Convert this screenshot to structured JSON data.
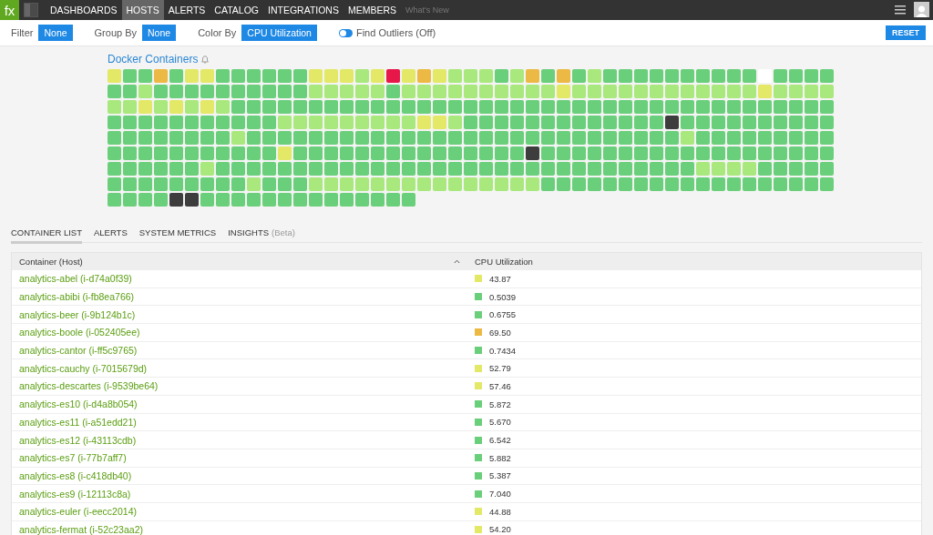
{
  "nav": {
    "logo": "fx",
    "items": [
      {
        "label": "DASHBOARDS",
        "selected": false
      },
      {
        "label": "HOSTS",
        "selected": true
      },
      {
        "label": "ALERTS",
        "selected": false
      },
      {
        "label": "CATALOG",
        "selected": false
      },
      {
        "label": "INTEGRATIONS",
        "selected": false
      },
      {
        "label": "MEMBERS",
        "selected": false
      }
    ],
    "whats_new": "What's New"
  },
  "toolbar": {
    "filters": [
      {
        "label": "Filter",
        "value": "None"
      },
      {
        "label": "Group By",
        "value": "None"
      },
      {
        "label": "Color By",
        "value": "CPU Utilization"
      }
    ],
    "outliers": {
      "label": "Find Outliers (Off)",
      "on": false
    },
    "reset": "RESET"
  },
  "heatmap": {
    "title": "Docker Containers",
    "rows": [
      {
        "cells": [
          {
            "color": "#e3e867"
          },
          {
            "color": "#6acf7a"
          },
          {
            "color": "#6acf7a"
          },
          {
            "color": "#ecb944"
          },
          {
            "color": "#6acf7a"
          },
          {
            "color": "#e3e867"
          },
          {
            "color": "#e3e867"
          },
          {
            "color": "#6acf7a"
          },
          {
            "color": "#6acf7a"
          },
          {
            "color": "#6acf7a"
          },
          {
            "color": "#6acf7a"
          },
          {
            "color": "#6acf7a"
          },
          {
            "color": "#6acf7a"
          },
          {
            "color": "#e3e867"
          },
          {
            "color": "#e3e867"
          },
          {
            "color": "#e3e867"
          },
          {
            "color": "#a9e87c"
          },
          {
            "color": "#e3e867"
          },
          {
            "color": "#e8174a"
          },
          {
            "color": "#e3e867"
          },
          {
            "color": "#ecb944"
          },
          {
            "color": "#e3e867"
          },
          {
            "color": "#a9e87c"
          },
          {
            "color": "#a9e87c"
          },
          {
            "color": "#a9e87c"
          },
          {
            "color": "#6acf7a"
          },
          {
            "color": "#a9e87c"
          },
          {
            "color": "#ecb944"
          },
          {
            "color": "#6acf7a"
          },
          {
            "color": "#ecb944"
          },
          {
            "color": "#6acf7a"
          },
          {
            "color": "#a9e87c"
          },
          {
            "color": "#6acf7a"
          },
          {
            "color": "#6acf7a"
          },
          {
            "color": "#6acf7a"
          },
          {
            "color": "#6acf7a"
          },
          {
            "color": "#6acf7a"
          },
          {
            "color": "#6acf7a"
          },
          {
            "color": "#6acf7a"
          },
          {
            "color": "#6acf7a"
          },
          {
            "color": "#6acf7a"
          },
          {
            "color": "#6acf7a"
          },
          {
            "color": "#ffffff"
          },
          {
            "color": "#6acf7a"
          },
          {
            "color": "#6acf7a"
          },
          {
            "color": "#6acf7a"
          },
          {
            "color": "#6acf7a"
          }
        ]
      },
      {
        "cells": [
          {
            "color": "#6acf7a"
          },
          {
            "color": "#6acf7a"
          },
          {
            "color": "#a9e87c"
          },
          {
            "color": "#6acf7a"
          },
          {
            "color": "#6acf7a"
          },
          {
            "color": "#6acf7a"
          },
          {
            "color": "#6acf7a"
          },
          {
            "color": "#6acf7a"
          },
          {
            "color": "#6acf7a"
          },
          {
            "color": "#6acf7a"
          },
          {
            "color": "#6acf7a"
          },
          {
            "color": "#6acf7a"
          },
          {
            "color": "#6acf7a"
          },
          {
            "color": "#a9e87c"
          },
          {
            "color": "#a9e87c"
          },
          {
            "color": "#a9e87c"
          },
          {
            "color": "#a9e87c"
          },
          {
            "color": "#a9e87c"
          },
          {
            "color": "#6acf7a"
          },
          {
            "color": "#a9e87c"
          },
          {
            "color": "#a9e87c"
          },
          {
            "color": "#a9e87c"
          },
          {
            "color": "#a9e87c"
          },
          {
            "color": "#a9e87c"
          },
          {
            "color": "#a9e87c"
          },
          {
            "color": "#a9e87c"
          },
          {
            "color": "#a9e87c"
          },
          {
            "color": "#a9e87c"
          },
          {
            "color": "#a9e87c"
          },
          {
            "color": "#e3e867"
          },
          {
            "color": "#a9e87c"
          },
          {
            "color": "#a9e87c"
          },
          {
            "color": "#a9e87c"
          },
          {
            "color": "#a9e87c"
          },
          {
            "color": "#a9e87c"
          },
          {
            "color": "#a9e87c"
          },
          {
            "color": "#a9e87c"
          },
          {
            "color": "#a9e87c"
          },
          {
            "color": "#a9e87c"
          },
          {
            "color": "#a9e87c"
          },
          {
            "color": "#a9e87c"
          },
          {
            "color": "#a9e87c"
          },
          {
            "color": "#e3e867"
          },
          {
            "color": "#a9e87c"
          },
          {
            "color": "#a9e87c"
          },
          {
            "color": "#a9e87c"
          },
          {
            "color": "#a9e87c"
          }
        ]
      },
      {
        "cells": [
          {
            "color": "#a9e87c"
          },
          {
            "color": "#a9e87c"
          },
          {
            "color": "#e3e867"
          },
          {
            "color": "#a9e87c"
          },
          {
            "color": "#e3e867"
          },
          {
            "color": "#a9e87c"
          },
          {
            "color": "#e3e867"
          },
          {
            "color": "#a9e87c"
          },
          {
            "color": "#6acf7a"
          },
          {
            "color": "#6acf7a"
          },
          {
            "color": "#6acf7a"
          },
          {
            "color": "#6acf7a"
          },
          {
            "color": "#6acf7a"
          },
          {
            "color": "#6acf7a"
          },
          {
            "color": "#6acf7a"
          },
          {
            "color": "#6acf7a"
          },
          {
            "color": "#6acf7a"
          },
          {
            "color": "#6acf7a"
          },
          {
            "color": "#6acf7a"
          },
          {
            "color": "#6acf7a"
          },
          {
            "color": "#6acf7a"
          },
          {
            "color": "#6acf7a"
          },
          {
            "color": "#6acf7a"
          },
          {
            "color": "#6acf7a"
          },
          {
            "color": "#6acf7a"
          },
          {
            "color": "#6acf7a"
          },
          {
            "color": "#6acf7a"
          },
          {
            "color": "#6acf7a"
          },
          {
            "color": "#6acf7a"
          },
          {
            "color": "#6acf7a"
          },
          {
            "color": "#6acf7a"
          },
          {
            "color": "#6acf7a"
          },
          {
            "color": "#6acf7a"
          },
          {
            "color": "#6acf7a"
          },
          {
            "color": "#6acf7a"
          },
          {
            "color": "#6acf7a"
          },
          {
            "color": "#6acf7a"
          },
          {
            "color": "#6acf7a"
          },
          {
            "color": "#6acf7a"
          },
          {
            "color": "#6acf7a"
          },
          {
            "color": "#6acf7a"
          },
          {
            "color": "#6acf7a"
          },
          {
            "color": "#6acf7a"
          },
          {
            "color": "#6acf7a"
          },
          {
            "color": "#6acf7a"
          },
          {
            "color": "#6acf7a"
          },
          {
            "color": "#6acf7a"
          }
        ]
      },
      {
        "cells": [
          {
            "color": "#6acf7a"
          },
          {
            "color": "#6acf7a"
          },
          {
            "color": "#6acf7a"
          },
          {
            "color": "#6acf7a"
          },
          {
            "color": "#6acf7a"
          },
          {
            "color": "#6acf7a"
          },
          {
            "color": "#6acf7a"
          },
          {
            "color": "#6acf7a"
          },
          {
            "color": "#6acf7a"
          },
          {
            "color": "#6acf7a"
          },
          {
            "color": "#6acf7a"
          },
          {
            "color": "#a9e87c"
          },
          {
            "color": "#a9e87c"
          },
          {
            "color": "#a9e87c"
          },
          {
            "color": "#a9e87c"
          },
          {
            "color": "#a9e87c"
          },
          {
            "color": "#a9e87c"
          },
          {
            "color": "#a9e87c"
          },
          {
            "color": "#a9e87c"
          },
          {
            "color": "#a9e87c"
          },
          {
            "color": "#e3e867"
          },
          {
            "color": "#e3e867"
          },
          {
            "color": "#a9e87c"
          },
          {
            "color": "#6acf7a"
          },
          {
            "color": "#6acf7a"
          },
          {
            "color": "#6acf7a"
          },
          {
            "color": "#6acf7a"
          },
          {
            "color": "#6acf7a"
          },
          {
            "color": "#6acf7a"
          },
          {
            "color": "#6acf7a"
          },
          {
            "color": "#6acf7a"
          },
          {
            "color": "#6acf7a"
          },
          {
            "color": "#6acf7a"
          },
          {
            "color": "#6acf7a"
          },
          {
            "color": "#6acf7a"
          },
          {
            "color": "#6acf7a"
          },
          {
            "color": "#3d3d3d"
          },
          {
            "color": "#6acf7a"
          },
          {
            "color": "#6acf7a"
          },
          {
            "color": "#6acf7a"
          },
          {
            "color": "#6acf7a"
          },
          {
            "color": "#6acf7a"
          },
          {
            "color": "#6acf7a"
          },
          {
            "color": "#6acf7a"
          },
          {
            "color": "#6acf7a"
          },
          {
            "color": "#6acf7a"
          },
          {
            "color": "#6acf7a"
          }
        ]
      },
      {
        "cells": [
          {
            "color": "#6acf7a"
          },
          {
            "color": "#6acf7a"
          },
          {
            "color": "#6acf7a"
          },
          {
            "color": "#6acf7a"
          },
          {
            "color": "#6acf7a"
          },
          {
            "color": "#6acf7a"
          },
          {
            "color": "#6acf7a"
          },
          {
            "color": "#6acf7a"
          },
          {
            "color": "#a9e87c"
          },
          {
            "color": "#6acf7a"
          },
          {
            "color": "#6acf7a"
          },
          {
            "color": "#6acf7a"
          },
          {
            "color": "#6acf7a"
          },
          {
            "color": "#6acf7a"
          },
          {
            "color": "#6acf7a"
          },
          {
            "color": "#6acf7a"
          },
          {
            "color": "#6acf7a"
          },
          {
            "color": "#6acf7a"
          },
          {
            "color": "#6acf7a"
          },
          {
            "color": "#6acf7a"
          },
          {
            "color": "#6acf7a"
          },
          {
            "color": "#6acf7a"
          },
          {
            "color": "#6acf7a"
          },
          {
            "color": "#6acf7a"
          },
          {
            "color": "#6acf7a"
          },
          {
            "color": "#6acf7a"
          },
          {
            "color": "#6acf7a"
          },
          {
            "color": "#6acf7a"
          },
          {
            "color": "#6acf7a"
          },
          {
            "color": "#6acf7a"
          },
          {
            "color": "#6acf7a"
          },
          {
            "color": "#6acf7a"
          },
          {
            "color": "#6acf7a"
          },
          {
            "color": "#6acf7a"
          },
          {
            "color": "#6acf7a"
          },
          {
            "color": "#6acf7a"
          },
          {
            "color": "#6acf7a"
          },
          {
            "color": "#a9e87c"
          },
          {
            "color": "#6acf7a"
          },
          {
            "color": "#6acf7a"
          },
          {
            "color": "#6acf7a"
          },
          {
            "color": "#6acf7a"
          },
          {
            "color": "#6acf7a"
          },
          {
            "color": "#6acf7a"
          },
          {
            "color": "#6acf7a"
          },
          {
            "color": "#6acf7a"
          },
          {
            "color": "#6acf7a"
          }
        ]
      },
      {
        "cells": [
          {
            "color": "#6acf7a"
          },
          {
            "color": "#6acf7a"
          },
          {
            "color": "#6acf7a"
          },
          {
            "color": "#6acf7a"
          },
          {
            "color": "#6acf7a"
          },
          {
            "color": "#6acf7a"
          },
          {
            "color": "#6acf7a"
          },
          {
            "color": "#6acf7a"
          },
          {
            "color": "#6acf7a"
          },
          {
            "color": "#6acf7a"
          },
          {
            "color": "#6acf7a"
          },
          {
            "color": "#e3e867"
          },
          {
            "color": "#6acf7a"
          },
          {
            "color": "#6acf7a"
          },
          {
            "color": "#6acf7a"
          },
          {
            "color": "#6acf7a"
          },
          {
            "color": "#6acf7a"
          },
          {
            "color": "#6acf7a"
          },
          {
            "color": "#6acf7a"
          },
          {
            "color": "#6acf7a"
          },
          {
            "color": "#6acf7a"
          },
          {
            "color": "#6acf7a"
          },
          {
            "color": "#6acf7a"
          },
          {
            "color": "#6acf7a"
          },
          {
            "color": "#6acf7a"
          },
          {
            "color": "#6acf7a"
          },
          {
            "color": "#6acf7a"
          },
          {
            "color": "#3d3d3d"
          },
          {
            "color": "#6acf7a"
          },
          {
            "color": "#6acf7a"
          },
          {
            "color": "#6acf7a"
          },
          {
            "color": "#6acf7a"
          },
          {
            "color": "#6acf7a"
          },
          {
            "color": "#6acf7a"
          },
          {
            "color": "#6acf7a"
          },
          {
            "color": "#6acf7a"
          },
          {
            "color": "#6acf7a"
          },
          {
            "color": "#6acf7a"
          },
          {
            "color": "#6acf7a"
          },
          {
            "color": "#6acf7a"
          },
          {
            "color": "#6acf7a"
          },
          {
            "color": "#6acf7a"
          },
          {
            "color": "#6acf7a"
          },
          {
            "color": "#6acf7a"
          },
          {
            "color": "#6acf7a"
          },
          {
            "color": "#6acf7a"
          },
          {
            "color": "#6acf7a"
          }
        ]
      },
      {
        "cells": [
          {
            "color": "#6acf7a"
          },
          {
            "color": "#6acf7a"
          },
          {
            "color": "#6acf7a"
          },
          {
            "color": "#6acf7a"
          },
          {
            "color": "#6acf7a"
          },
          {
            "color": "#6acf7a"
          },
          {
            "color": "#a9e87c"
          },
          {
            "color": "#6acf7a"
          },
          {
            "color": "#6acf7a"
          },
          {
            "color": "#6acf7a"
          },
          {
            "color": "#6acf7a"
          },
          {
            "color": "#6acf7a"
          },
          {
            "color": "#6acf7a"
          },
          {
            "color": "#6acf7a"
          },
          {
            "color": "#6acf7a"
          },
          {
            "color": "#6acf7a"
          },
          {
            "color": "#6acf7a"
          },
          {
            "color": "#6acf7a"
          },
          {
            "color": "#6acf7a"
          },
          {
            "color": "#6acf7a"
          },
          {
            "color": "#6acf7a"
          },
          {
            "color": "#6acf7a"
          },
          {
            "color": "#6acf7a"
          },
          {
            "color": "#6acf7a"
          },
          {
            "color": "#6acf7a"
          },
          {
            "color": "#6acf7a"
          },
          {
            "color": "#6acf7a"
          },
          {
            "color": "#6acf7a"
          },
          {
            "color": "#6acf7a"
          },
          {
            "color": "#6acf7a"
          },
          {
            "color": "#6acf7a"
          },
          {
            "color": "#6acf7a"
          },
          {
            "color": "#6acf7a"
          },
          {
            "color": "#6acf7a"
          },
          {
            "color": "#6acf7a"
          },
          {
            "color": "#6acf7a"
          },
          {
            "color": "#6acf7a"
          },
          {
            "color": "#6acf7a"
          },
          {
            "color": "#a9e87c"
          },
          {
            "color": "#a9e87c"
          },
          {
            "color": "#a9e87c"
          },
          {
            "color": "#a9e87c"
          },
          {
            "color": "#6acf7a"
          },
          {
            "color": "#6acf7a"
          },
          {
            "color": "#6acf7a"
          },
          {
            "color": "#6acf7a"
          },
          {
            "color": "#6acf7a"
          }
        ]
      },
      {
        "cells": [
          {
            "color": "#6acf7a"
          },
          {
            "color": "#6acf7a"
          },
          {
            "color": "#6acf7a"
          },
          {
            "color": "#6acf7a"
          },
          {
            "color": "#6acf7a"
          },
          {
            "color": "#6acf7a"
          },
          {
            "color": "#6acf7a"
          },
          {
            "color": "#6acf7a"
          },
          {
            "color": "#6acf7a"
          },
          {
            "color": "#a9e87c"
          },
          {
            "color": "#6acf7a"
          },
          {
            "color": "#6acf7a"
          },
          {
            "color": "#6acf7a"
          },
          {
            "color": "#a9e87c"
          },
          {
            "color": "#a9e87c"
          },
          {
            "color": "#a9e87c"
          },
          {
            "color": "#a9e87c"
          },
          {
            "color": "#a9e87c"
          },
          {
            "color": "#a9e87c"
          },
          {
            "color": "#a9e87c"
          },
          {
            "color": "#a9e87c"
          },
          {
            "color": "#a9e87c"
          },
          {
            "color": "#a9e87c"
          },
          {
            "color": "#a9e87c"
          },
          {
            "color": "#a9e87c"
          },
          {
            "color": "#a9e87c"
          },
          {
            "color": "#a9e87c"
          },
          {
            "color": "#a9e87c"
          },
          {
            "color": "#6acf7a"
          },
          {
            "color": "#6acf7a"
          },
          {
            "color": "#6acf7a"
          },
          {
            "color": "#6acf7a"
          },
          {
            "color": "#6acf7a"
          },
          {
            "color": "#6acf7a"
          },
          {
            "color": "#6acf7a"
          },
          {
            "color": "#6acf7a"
          },
          {
            "color": "#6acf7a"
          },
          {
            "color": "#6acf7a"
          },
          {
            "color": "#6acf7a"
          },
          {
            "color": "#6acf7a"
          },
          {
            "color": "#6acf7a"
          },
          {
            "color": "#6acf7a"
          },
          {
            "color": "#6acf7a"
          },
          {
            "color": "#6acf7a"
          },
          {
            "color": "#6acf7a"
          },
          {
            "color": "#6acf7a"
          },
          {
            "color": "#6acf7a"
          }
        ]
      },
      {
        "cells": [
          {
            "color": "#6acf7a"
          },
          {
            "color": "#6acf7a"
          },
          {
            "color": "#6acf7a"
          },
          {
            "color": "#6acf7a"
          },
          {
            "color": "#3d3d3d"
          },
          {
            "color": "#3d3d3d"
          },
          {
            "color": "#6acf7a"
          },
          {
            "color": "#6acf7a"
          },
          {
            "color": "#6acf7a"
          },
          {
            "color": "#6acf7a"
          },
          {
            "color": "#6acf7a"
          },
          {
            "color": "#6acf7a"
          },
          {
            "color": "#6acf7a"
          },
          {
            "color": "#6acf7a"
          },
          {
            "color": "#6acf7a"
          },
          {
            "color": "#6acf7a"
          },
          {
            "color": "#6acf7a"
          },
          {
            "color": "#6acf7a"
          },
          {
            "color": "#6acf7a"
          },
          {
            "color": "#6acf7a"
          }
        ]
      }
    ]
  },
  "tabs": [
    {
      "label": "CONTAINER LIST",
      "selected": true
    },
    {
      "label": "ALERTS",
      "selected": false
    },
    {
      "label": "SYSTEM METRICS",
      "selected": false
    },
    {
      "label": "INSIGHTS",
      "badge": "(Beta)",
      "selected": false
    }
  ],
  "table": {
    "columns": [
      "Container (Host)",
      "CPU Utilization"
    ],
    "rows": [
      {
        "name": "analytics-abel (i-d74a0f39)",
        "color": "#e3e867",
        "value": "43.87"
      },
      {
        "name": "analytics-abibi (i-fb8ea766)",
        "color": "#6acf7a",
        "value": "0.5039"
      },
      {
        "name": "analytics-beer (i-9b124b1c)",
        "color": "#6acf7a",
        "value": "0.6755"
      },
      {
        "name": "analytics-boole (i-052405ee)",
        "color": "#ecb944",
        "value": "69.50"
      },
      {
        "name": "analytics-cantor (i-ff5c9765)",
        "color": "#6acf7a",
        "value": "0.7434"
      },
      {
        "name": "analytics-cauchy (i-7015679d)",
        "color": "#e3e867",
        "value": "52.79"
      },
      {
        "name": "analytics-descartes (i-9539be64)",
        "color": "#e3e867",
        "value": "57.46"
      },
      {
        "name": "analytics-es10 (i-d4a8b054)",
        "color": "#6acf7a",
        "value": "5.872"
      },
      {
        "name": "analytics-es11 (i-a51edd21)",
        "color": "#6acf7a",
        "value": "5.670"
      },
      {
        "name": "analytics-es12 (i-43113cdb)",
        "color": "#6acf7a",
        "value": "6.542"
      },
      {
        "name": "analytics-es7 (i-77b7aff7)",
        "color": "#6acf7a",
        "value": "5.882"
      },
      {
        "name": "analytics-es8 (i-c418db40)",
        "color": "#6acf7a",
        "value": "5.387"
      },
      {
        "name": "analytics-es9 (i-12113c8a)",
        "color": "#6acf7a",
        "value": "7.040"
      },
      {
        "name": "analytics-euler (i-eecc2014)",
        "color": "#e3e867",
        "value": "44.88"
      },
      {
        "name": "analytics-fermat (i-52c23aa2)",
        "color": "#e3e867",
        "value": "54.20"
      }
    ]
  }
}
